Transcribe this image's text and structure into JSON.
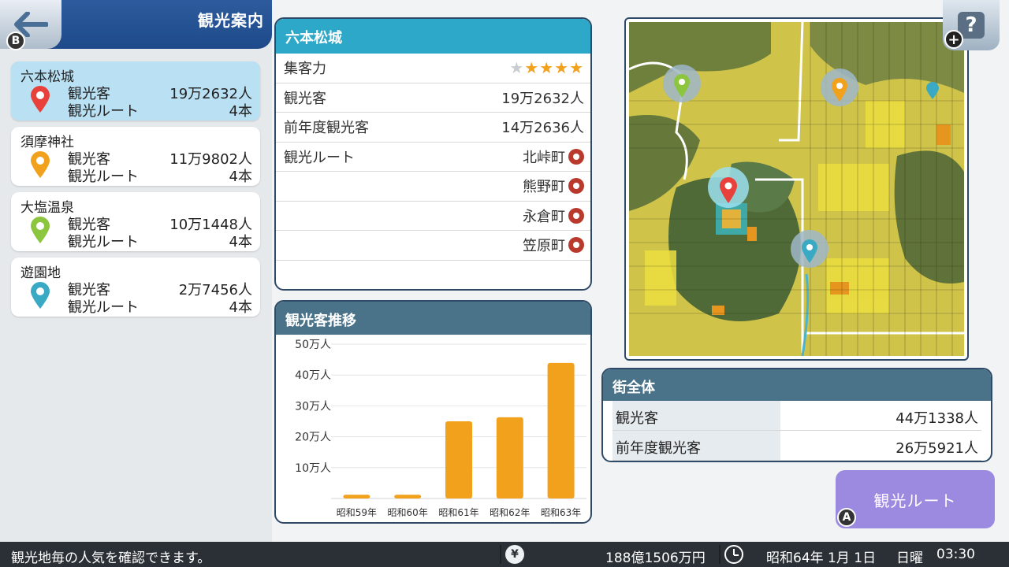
{
  "header": {
    "title": "観光案内",
    "back_badge": "B"
  },
  "spots": [
    {
      "name": "六本松城",
      "visitors_label": "観光客",
      "visitors": "19万2632人",
      "routes_label": "観光ルート",
      "routes": "4本",
      "pin_color": "#e8403a",
      "selected": true
    },
    {
      "name": "須摩神社",
      "visitors_label": "観光客",
      "visitors": "11万9802人",
      "routes_label": "観光ルート",
      "routes": "4本",
      "pin_color": "#f2a11d",
      "selected": false
    },
    {
      "name": "大塩温泉",
      "visitors_label": "観光客",
      "visitors": "10万1448人",
      "routes_label": "観光ルート",
      "routes": "4本",
      "pin_color": "#8cc63e",
      "selected": false
    },
    {
      "name": "遊園地",
      "visitors_label": "観光客",
      "visitors": "2万7456人",
      "routes_label": "観光ルート",
      "routes": "4本",
      "pin_color": "#3aa9c4",
      "selected": false
    }
  ],
  "info": {
    "title": "六本松城",
    "attraction_label": "集客力",
    "attraction_stars": 4,
    "attraction_max": 5,
    "visitors_label": "観光客",
    "visitors": "19万2632人",
    "prev_visitors_label": "前年度観光客",
    "prev_visitors": "14万2636人",
    "routes_label": "観光ルート",
    "routes": [
      "北峠町",
      "熊野町",
      "永倉町",
      "笠原町"
    ]
  },
  "chart_title": "観光客推移",
  "chart_data": {
    "type": "bar",
    "categories": [
      "昭和59年",
      "昭和60年",
      "昭和61年",
      "昭和62年",
      "昭和63年"
    ],
    "values": [
      1.2,
      1.2,
      25,
      26.3,
      43.9
    ],
    "ylim": [
      0,
      50
    ],
    "ytick_labels": [
      "10万人",
      "20万人",
      "30万人",
      "40万人",
      "50万人"
    ],
    "yticks": [
      10,
      20,
      30,
      40,
      50
    ],
    "bar_color": "#f2a11d"
  },
  "map": {
    "help_label": "?",
    "plus_badge": "+"
  },
  "town": {
    "title": "街全体",
    "visitors_label": "観光客",
    "visitors": "44万1338人",
    "prev_visitors_label": "前年度観光客",
    "prev_visitors": "26万5921人"
  },
  "route_button": {
    "label": "観光ルート",
    "badge": "A"
  },
  "status": {
    "message": "観光地毎の人気を確認できます。",
    "money_icon": "¥",
    "money": "188億1506万円",
    "date": "昭和64年 1月 1日",
    "weekday": "日曜",
    "time": "03:30"
  }
}
